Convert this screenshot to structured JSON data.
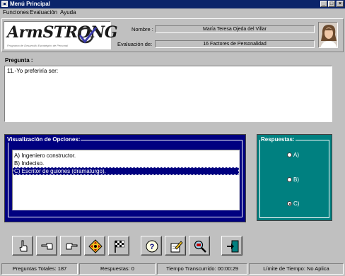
{
  "window": {
    "title": "Menú Principal",
    "controls": [
      "minimize",
      "maximize",
      "close"
    ]
  },
  "menu": {
    "items": [
      "Funciones",
      "Evaluación",
      "Ayuda"
    ]
  },
  "logo": {
    "text": "ArmSTRONG",
    "tagline": "Programa de Desarrollo Estratégico de Personal"
  },
  "header": {
    "nombre_label": "Nombre :",
    "nombre_value": "María Teresa Ojeda del Villar",
    "evaluacion_label": "Evaluación de:",
    "evaluacion_value": "16 Factores de Personalidad"
  },
  "pregunta": {
    "label": "Pregunta :",
    "text": "11.-Yo preferiría ser:"
  },
  "opciones": {
    "title": "Visualización de Opciones:",
    "items": [
      {
        "label": "A) Ingeniero constructor.",
        "selected": false
      },
      {
        "label": "B) Indeciso.",
        "selected": false
      },
      {
        "label": "C) Escritor de guiones (dramaturgo).",
        "selected": true
      }
    ]
  },
  "respuestas": {
    "title": "Respuestas:",
    "options": [
      {
        "label": "A)",
        "checked": false
      },
      {
        "label": "B)",
        "checked": false
      },
      {
        "label": "C)",
        "checked": true
      }
    ]
  },
  "toolbar": {
    "buttons": [
      "pointing-up-hand-icon",
      "pointing-left-hand-icon",
      "pointing-right-hand-icon",
      "directional-pad-icon",
      "checkered-flag-icon",
      "help-icon",
      "edit-document-icon",
      "magnifier-icon",
      "exit-door-icon"
    ]
  },
  "status": {
    "preguntas_totales": "Preguntas Totales: 187",
    "respuestas": "Respuestas: 0",
    "tiempo_transcurrido": "Tiempo Transcurrido: 00:00:29",
    "limite_tiempo": "Límite de Tiempo: No Aplica"
  },
  "colors": {
    "titlebar": "#0a246a",
    "opciones_panel": "#000080",
    "respuestas_panel": "#008080",
    "face": "#c0c0c0"
  }
}
